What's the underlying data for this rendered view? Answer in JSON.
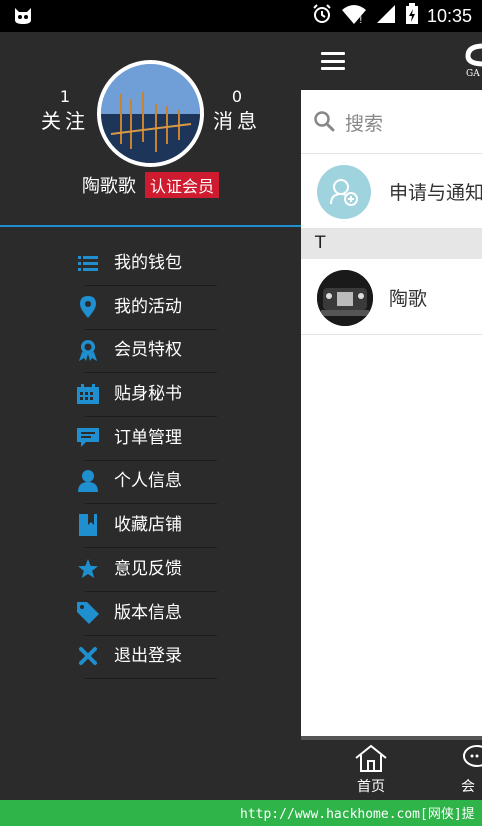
{
  "status_bar": {
    "time": "10:35"
  },
  "profile": {
    "follow_count": "1",
    "follow_label": "关注",
    "message_count": "0",
    "message_label": "消息",
    "username": "陶歌歌",
    "badge": "认证会员"
  },
  "menu": {
    "items": [
      {
        "label": "我的钱包",
        "icon": "list-icon"
      },
      {
        "label": "我的活动",
        "icon": "location-pin-icon"
      },
      {
        "label": "会员特权",
        "icon": "ribbon-icon"
      },
      {
        "label": "贴身秘书",
        "icon": "calendar-icon"
      },
      {
        "label": "订单管理",
        "icon": "chat-icon"
      },
      {
        "label": "个人信息",
        "icon": "person-icon"
      },
      {
        "label": "收藏店铺",
        "icon": "bookmark-icon"
      },
      {
        "label": "意见反馈",
        "icon": "star-icon"
      },
      {
        "label": "版本信息",
        "icon": "tag-icon"
      },
      {
        "label": "退出登录",
        "icon": "close-icon"
      }
    ]
  },
  "main": {
    "search_placeholder": "搜索",
    "notice_label": "申请与通知",
    "section_letter": "T",
    "contact_name": "陶歌",
    "nav_home": "首页",
    "nav_second": "会"
  },
  "watermark": "http://www.hackhome.com[网侠]提供",
  "colors": {
    "accent": "#1f8fd0",
    "badge": "#cf1b2f",
    "drawer_bg": "#2b2b2b"
  }
}
